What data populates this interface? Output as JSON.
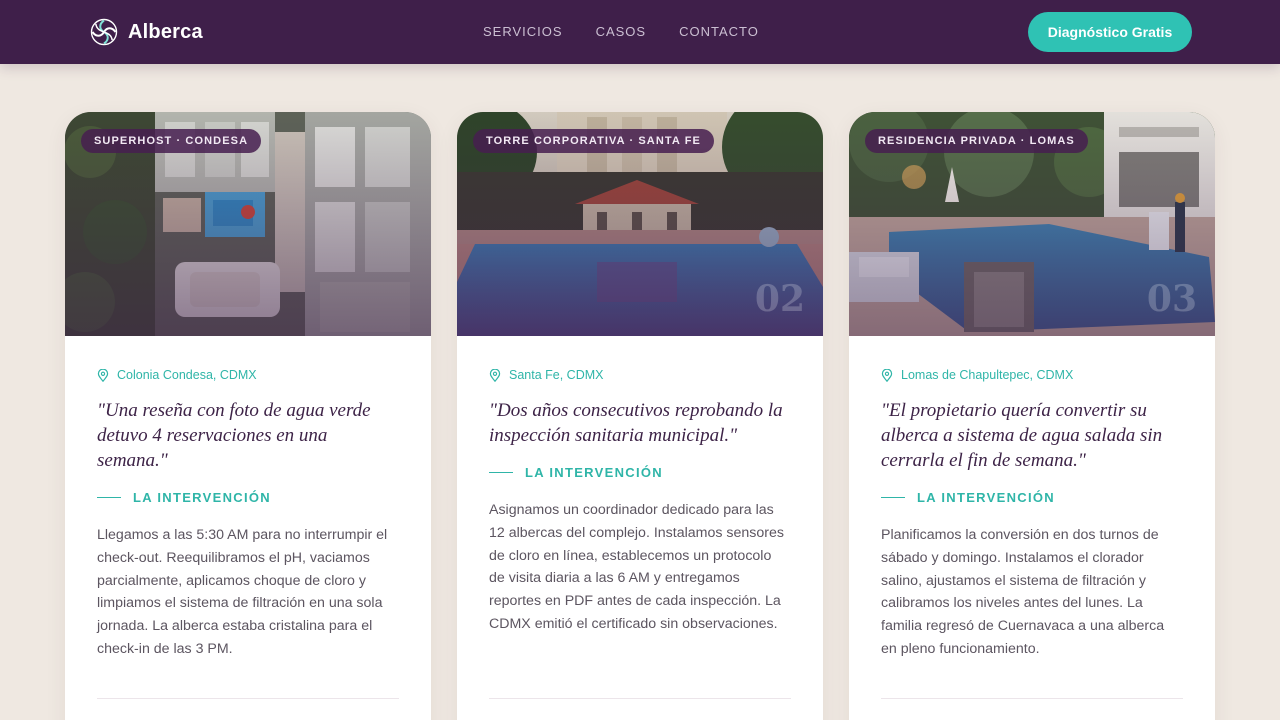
{
  "nav": {
    "brand": "Alberca",
    "links": [
      "SERVICIOS",
      "CASOS",
      "CONTACTO"
    ],
    "cta": "Diagnóstico Gratis"
  },
  "cards": [
    {
      "badge": "SUPERHOST · CONDESA",
      "location": "Colonia Condesa, CDMX",
      "quote": "\"Una reseña con foto de agua verde detuvo 4 reservaciones en una semana.\"",
      "intervention_label": "LA INTERVENCIÓN",
      "description": "Llegamos a las 5:30 AM para no interrumpir el check-out. Reequilibramos el pH, vaciamos parcialmente, aplicamos choque de cloro y limpiamos el sistema de filtración en una sola jornada. La alberca estaba cristalina para el check-in de las 3 PM."
    },
    {
      "badge": "TORRE CORPORATIVA · SANTA FE",
      "number": "02",
      "location": "Santa Fe, CDMX",
      "quote": "\"Dos años consecutivos reprobando la inspección sanitaria municipal.\"",
      "intervention_label": "LA INTERVENCIÓN",
      "description": "Asignamos un coordinador dedicado para las 12 albercas del complejo. Instalamos sensores de cloro en línea, establecemos un protocolo de visita diaria a las 6 AM y entregamos reportes en PDF antes de cada inspección. La CDMX emitió el certificado sin observaciones."
    },
    {
      "badge": "RESIDENCIA PRIVADA · LOMAS",
      "number": "03",
      "location": "Lomas de Chapultepec, CDMX",
      "quote": "\"El propietario quería convertir su alberca a sistema de agua salada sin cerrarla el fin de semana.\"",
      "intervention_label": "LA INTERVENCIÓN",
      "description": "Planificamos la conversión en dos turnos de sábado y domingo. Instalamos el clorador salino, ajustamos el sistema de filtración y calibramos los niveles antes del lunes. La familia regresó de Cuernavaca a una alberca en pleno funcionamiento."
    }
  ],
  "colors": {
    "nav_bg": "#3f1f4a",
    "accent": "#2fc2b4",
    "page_bg": "#efe8e1",
    "quote_text": "#3d2347"
  },
  "icons": {
    "brand": "swirl-logo-icon",
    "location": "map-pin-icon"
  }
}
